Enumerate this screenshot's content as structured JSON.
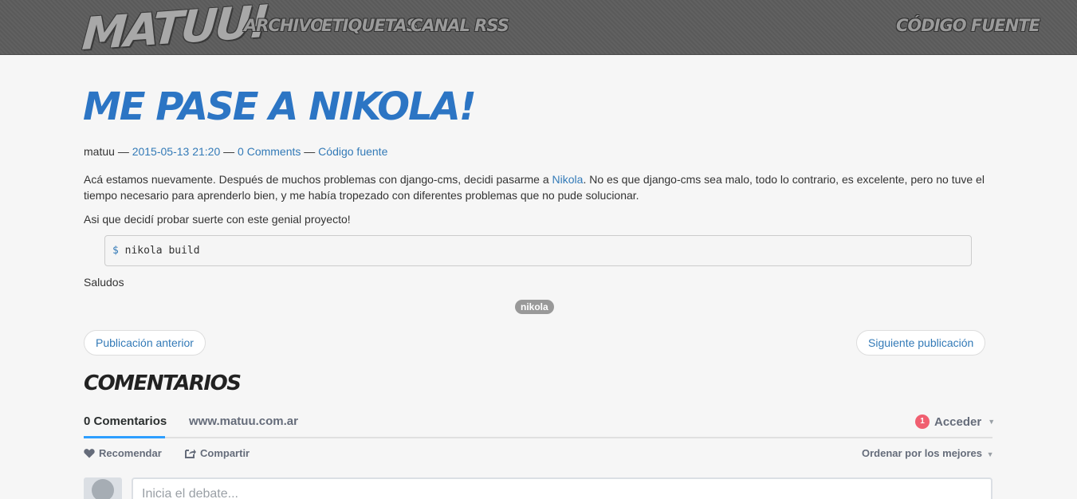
{
  "nav": {
    "brand": "MATUU!",
    "links": [
      "ARCHIVO",
      "ETIQUETAS",
      "CANAL RSS"
    ],
    "source": "CÓDIGO FUENTE"
  },
  "post": {
    "title": "ME PASE A NIKOLA!",
    "meta": {
      "author": "matuu",
      "sep": "—",
      "date": "2015-05-13 21:20",
      "comments": "0 Comments",
      "source": "Código fuente"
    },
    "p1_a": "Acá estamos nuevamente. Después de muchos problemas con django-cms, decidi pasarme a ",
    "p1_link": "Nikola",
    "p1_b": ". No es que django-cms sea malo, todo lo contrario, es excelente, pero no tuve el tiempo necesario para aprenderlo bien, y me había tropezado con diferentes problemas que no pude solucionar.",
    "p2": "Asi que decidí probar suerte con este genial proyecto!",
    "code_prompt": "$",
    "code_cmd": "nikola build",
    "p3": "Saludos",
    "tag": "nikola"
  },
  "pager": {
    "prev": "Publicación anterior",
    "next": "Siguiente publicación"
  },
  "comments": {
    "heading": "COMENTARIOS",
    "count_tab": "0 Comentarios",
    "site_tab": "www.matuu.com.ar",
    "badge": "1",
    "login": "Acceder",
    "recommend": "Recomendar",
    "share": "Compartir",
    "sort": "Ordenar por los mejores",
    "input_placeholder": "Inicia el debate..."
  },
  "colors": {
    "accent": "#2c75c4",
    "link": "#337ab7",
    "badge": "#f05f70"
  }
}
